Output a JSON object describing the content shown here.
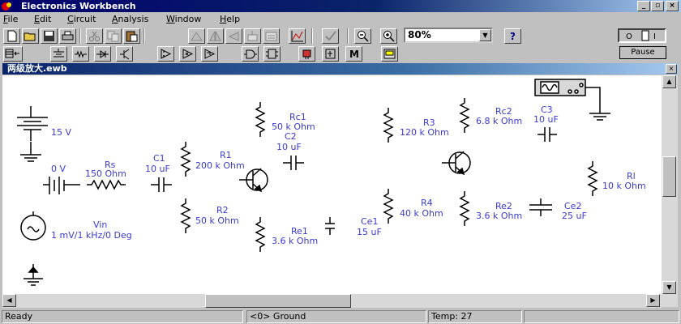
{
  "window": {
    "title": "Electronics Workbench"
  },
  "menu": [
    {
      "label": "File",
      "key": "F",
      "rest": "ile"
    },
    {
      "label": "Edit",
      "key": "E",
      "rest": "dit"
    },
    {
      "label": "Circuit",
      "key": "C",
      "rest": "ircuit"
    },
    {
      "label": "Analysis",
      "key": "A",
      "rest": "nalysis"
    },
    {
      "label": "Window",
      "key": "W",
      "rest": "indow"
    },
    {
      "label": "Help",
      "key": "H",
      "rest": "elp"
    }
  ],
  "toolbar": {
    "zoom_value": "80%",
    "help_label": "?",
    "pause_label": "Pause",
    "m_label": "M"
  },
  "document": {
    "title": "两级放大.ewb"
  },
  "components": {
    "battery_15v": "15 V",
    "zero_v": "0 V",
    "rs_name": "Rs",
    "rs_value": "150  Ohm",
    "c1_name": "C1",
    "c1_value": "10 uF",
    "r1_name": "R1",
    "r1_value": "200 k Ohm",
    "r2_name": "R2",
    "r2_value": "50 k Ohm",
    "rc1_name": "Rc1",
    "rc1_value": "50 k Ohm",
    "c2_name": "C2",
    "c2_value": "10 uF",
    "re1_name": "Re1",
    "re1_value": "3.6 k Ohm",
    "ce1_name": "Ce1",
    "ce1_value": "15 uF",
    "vin_name": "Vin",
    "vin_value": "1 mV/1 kHz/0 Deg",
    "r3_name": "R3",
    "r3_value": "120 k Ohm",
    "rc2_name": "Rc2",
    "rc2_value": "6.8 k Ohm",
    "c3_name": "C3",
    "c3_value": "10 uF",
    "r4_name": "R4",
    "r4_value": "40 k Ohm",
    "re2_name": "Re2",
    "re2_value": "3.6 k Ohm",
    "ce2_name": "Ce2",
    "ce2_value": "25 uF",
    "rl_name": "Rl",
    "rl_value": "10 k Ohm"
  },
  "status": {
    "ready": "Ready",
    "ground": "<0> Ground",
    "temp": "Temp:  27"
  },
  "colors": {
    "label": "#3a3ad0",
    "title_bar": "#0a246a",
    "face": "#c0c0c0"
  }
}
